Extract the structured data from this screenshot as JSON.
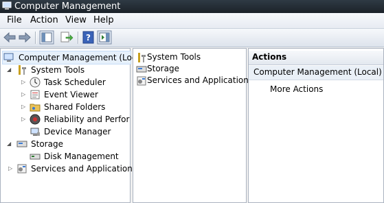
{
  "window": {
    "title": "Computer Management"
  },
  "menu": {
    "items": [
      "File",
      "Action",
      "View",
      "Help"
    ]
  },
  "toolbar": {
    "buttons": [
      "back-icon",
      "forward-icon",
      "show-hide-console-tree-icon",
      "export-list-icon",
      "help-icon",
      "show-hide-action-pane-icon"
    ]
  },
  "tree": {
    "root": "Computer Management (Local",
    "system_tools": "System Tools",
    "task_scheduler": "Task Scheduler",
    "event_viewer": "Event Viewer",
    "shared_folders": "Shared Folders",
    "reliability": "Reliability and Performa",
    "device_manager": "Device Manager",
    "storage": "Storage",
    "disk_management": "Disk Management",
    "services": "Services and Applications"
  },
  "details": {
    "items": [
      "System Tools",
      "Storage",
      "Services and Applications"
    ]
  },
  "actions": {
    "header": "Actions",
    "section": "Computer Management (Local)",
    "more": "More Actions"
  },
  "colors": {
    "titlebar": "#1e262d",
    "selection": "#e6f0fb",
    "pane_border": "#aab2bf"
  }
}
